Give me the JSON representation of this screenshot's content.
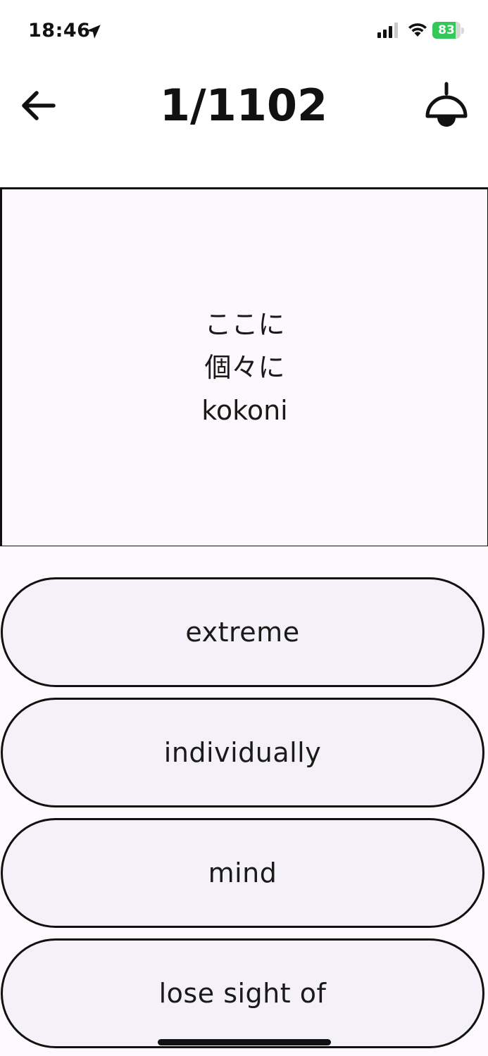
{
  "status_bar": {
    "time": "18:46",
    "battery_percent": "83",
    "battery_level": 0.83,
    "icons": [
      "location-arrow-icon",
      "signal-bars-icon",
      "wifi-icon",
      "battery-charging-icon"
    ]
  },
  "header": {
    "title": "1/1102",
    "back_icon": "arrow-left-icon",
    "action_icon": "lamp-icon"
  },
  "card": {
    "lines": [
      "ここに",
      "個々に",
      "kokoni"
    ]
  },
  "options": [
    {
      "label": "extreme"
    },
    {
      "label": "individually"
    },
    {
      "label": "mind"
    },
    {
      "label": "lose sight of"
    }
  ],
  "colors": {
    "text": "#111111",
    "card_background": "#fcf8fc",
    "option_background": "#f4f1f8",
    "battery_green": "#34c759"
  }
}
